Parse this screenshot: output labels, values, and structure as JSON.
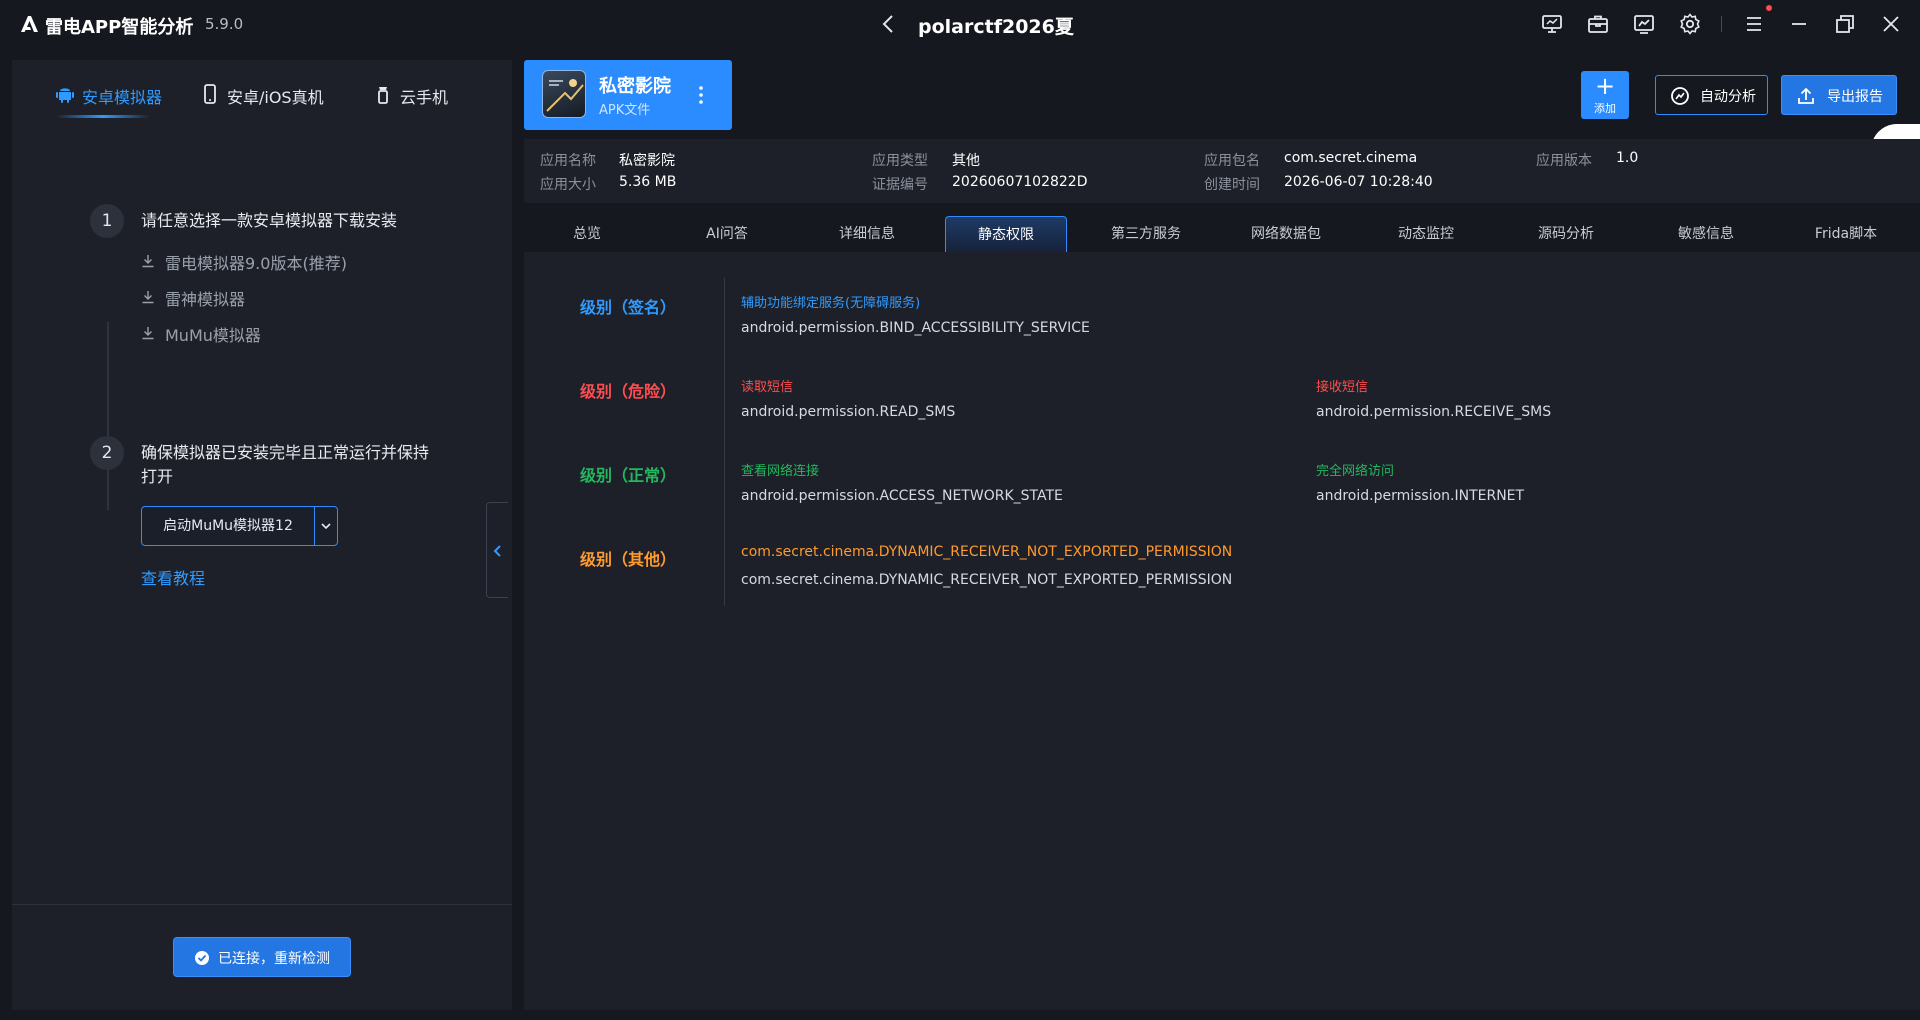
{
  "titlebar": {
    "app_name": "雷电APP智能分析",
    "version": "5.9.0",
    "window_title": "polarctf2026夏",
    "icons": [
      "screen-icon",
      "toolbox-icon",
      "monitor-chart-icon",
      "settings-gear-icon",
      "menu-icon",
      "minimize-icon",
      "restore-icon",
      "close-icon"
    ]
  },
  "left_panel": {
    "tabs": [
      {
        "label": "安卓模拟器",
        "icon": "android-icon",
        "active": true
      },
      {
        "label": "安卓/iOS真机",
        "icon": "phone-icon",
        "active": false
      },
      {
        "label": "云手机",
        "icon": "cloud-phone-icon",
        "active": false
      }
    ],
    "step1": {
      "number": "1",
      "text": "请任意选择一款安卓模拟器下载安装",
      "downloads": [
        "雷电模拟器9.0版本(推荐)",
        "雷神模拟器",
        "MuMu模拟器"
      ]
    },
    "step2": {
      "number": "2",
      "text_line1": "确保模拟器已安装完毕且正常运行并保持",
      "text_line2": "打开",
      "launch_label": "启动MuMu模拟器12"
    },
    "tutorial_link": "查看教程",
    "reconnect_label": "已连接，重新检测"
  },
  "app_card": {
    "name": "私密影院",
    "type": "APK文件"
  },
  "actions": {
    "add_label": "添加",
    "auto_analyze_label": "自动分析",
    "export_label": "导出报告"
  },
  "info": {
    "app_name_label": "应用名称",
    "app_name_value": "私密影院",
    "app_size_label": "应用大小",
    "app_size_value": "5.36 MB",
    "app_type_label": "应用类型",
    "app_type_value": "其他",
    "evidence_label": "证据编号",
    "evidence_value": "20260607102822D",
    "package_label": "应用包名",
    "package_value": "com.secret.cinema",
    "created_label": "创建时间",
    "created_value": "2026-06-07 10:28:40",
    "version_label": "应用版本",
    "version_value": "1.0"
  },
  "tabs": [
    "总览",
    "AI问答",
    "详细信息",
    "静态权限",
    "第三方服务",
    "网络数据包",
    "动态监控",
    "源码分析",
    "敏感信息",
    "Frida脚本"
  ],
  "active_tab": "静态权限",
  "permissions": {
    "signature": {
      "label": "级别（签名）",
      "color": "#2f9bff",
      "items": [
        {
          "desc": "辅助功能绑定服务(无障碍服务)",
          "name": "android.permission.BIND_ACCESSIBILITY_SERVICE"
        }
      ]
    },
    "dangerous": {
      "label": "级别（危险）",
      "color": "#ff4d4f",
      "items": [
        {
          "desc": "读取短信",
          "name": "android.permission.READ_SMS"
        },
        {
          "desc": "接收短信",
          "name": "android.permission.RECEIVE_SMS"
        }
      ]
    },
    "normal": {
      "label": "级别（正常）",
      "color": "#22b85e",
      "items": [
        {
          "desc": "查看网络连接",
          "name": "android.permission.ACCESS_NETWORK_STATE"
        },
        {
          "desc": "完全网络访问",
          "name": "android.permission.INTERNET"
        }
      ]
    },
    "other": {
      "label": "级别（其他）",
      "color": "#ff9a2e",
      "items": [
        {
          "desc": "com.secret.cinema.DYNAMIC_RECEIVER_NOT_EXPORTED_PERMISSION",
          "name": "com.secret.cinema.DYNAMIC_RECEIVER_NOT_EXPORTED_PERMISSION"
        }
      ]
    }
  }
}
